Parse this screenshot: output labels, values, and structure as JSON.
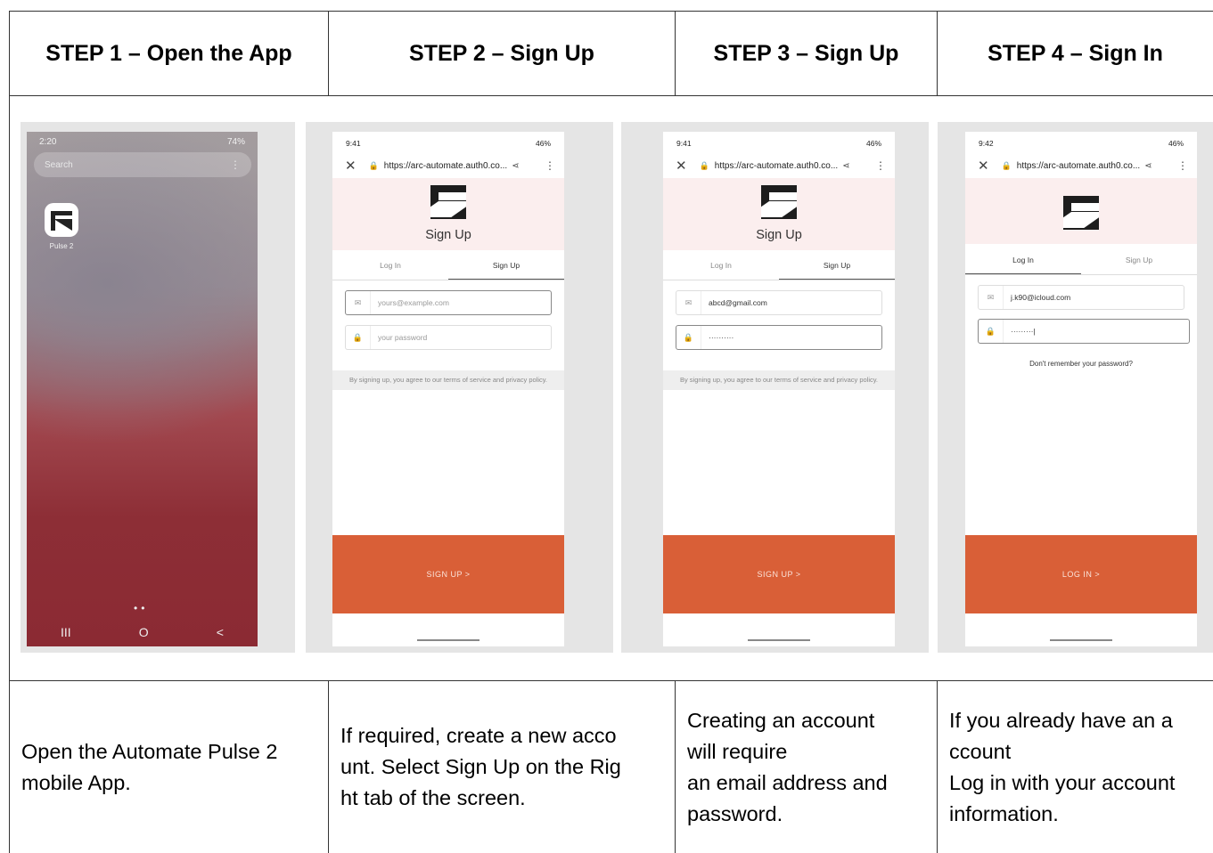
{
  "headers": [
    "STEP 1 – Open the App",
    "STEP 2 – Sign Up",
    "STEP 3 – Sign Up",
    "STEP 4 – Sign In"
  ],
  "descriptions": [
    [
      "Open the Automate Pulse 2",
      "mobile App."
    ],
    [
      "If required, create a new acco",
      "unt. Select Sign Up on the Rig",
      "ht tab of the screen."
    ],
    [
      "Creating an account",
      "will require",
      "an email address and",
      "password."
    ],
    [
      "If you already have an a",
      "ccount",
      "Log in with your account",
      "information."
    ]
  ],
  "phone1": {
    "time": "2:20",
    "status_right": "74%",
    "search_placeholder": "Search",
    "app_label": "Pulse 2",
    "nav_recent": "III",
    "nav_home": "O",
    "nav_back": "<"
  },
  "phone2": {
    "time": "9:41",
    "battery": "46%",
    "url": "https://arc-automate.auth0.co...",
    "hero_title": "Sign Up",
    "tab_login": "Log In",
    "tab_signup": "Sign Up",
    "email_placeholder": "yours@example.com",
    "password_placeholder": "your password",
    "terms": "By signing up, you agree to our terms of service and privacy policy.",
    "button": "SIGN UP >"
  },
  "phone3": {
    "time": "9:41",
    "battery": "46%",
    "url": "https://arc-automate.auth0.co...",
    "hero_title": "Sign Up",
    "tab_login": "Log In",
    "tab_signup": "Sign Up",
    "email_value": "abcd@gmail.com",
    "password_value": "··········",
    "terms": "By signing up, you agree to our terms of service and privacy policy.",
    "button": "SIGN UP >"
  },
  "phone4": {
    "time": "9:42",
    "battery": "46%",
    "url": "https://arc-automate.auth0.co...",
    "tab_login": "Log In",
    "tab_signup": "Sign Up",
    "email_value": "j.k90@icloud.com",
    "password_value": "·········|",
    "forgot": "Don't remember your password?",
    "button": "LOG IN >"
  }
}
